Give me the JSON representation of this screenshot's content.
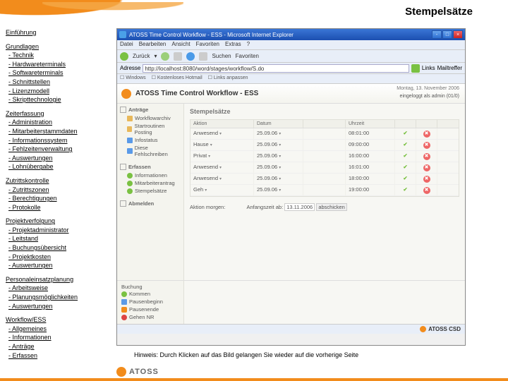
{
  "page": {
    "title": "Stempelsätze",
    "hint": "Hinweis: Durch Klicken auf das Bild gelangen Sie wieder auf die vorherige Seite"
  },
  "nav": [
    {
      "head": "Einführung",
      "items": []
    },
    {
      "head": "Grundlagen",
      "items": [
        "Technik",
        "Hardwareterminals",
        "Softwareterminals",
        "Schnittstellen",
        "Lizenzmodell",
        "Skripttechnologie"
      ]
    },
    {
      "head": "Zeiterfassung",
      "items": [
        "Administration",
        "Mitarbeiterstammdaten",
        "Informationssystem",
        "Fehlzeitenverwaltung",
        "Auswertungen",
        "Lohnübergabe"
      ]
    },
    {
      "head": "Zutrittskontrolle",
      "items": [
        "Zutrittszonen",
        "Berechtigungen",
        "Protokolle"
      ]
    },
    {
      "head": "Projektverfolgung",
      "items": [
        "Projektadministrator",
        "Leitstand",
        "Buchungsübersicht",
        "Projektkosten",
        "Auswertungen"
      ]
    },
    {
      "head": "Personaleinsatzplanung",
      "items": [
        "Arbeitsweise",
        "Planungsmöglichkeiten",
        "Auswertungen"
      ]
    },
    {
      "head": "Workflow/ESS",
      "items": [
        "Allgemeines",
        "Informationen",
        "Anträge",
        "Erfassen"
      ]
    }
  ],
  "browser": {
    "title": "ATOSS Time Control Workflow - ESS - Microsoft Internet Explorer",
    "menus": [
      "Datei",
      "Bearbeiten",
      "Ansicht",
      "Favoriten",
      "Extras",
      "?"
    ],
    "buttons": {
      "back": "Zurück",
      "search": "Suchen",
      "fav": "Favoriten"
    },
    "addr_label": "Adresse",
    "url": "http://localhost:8080/word/stages/workflow/S.do",
    "links_label": "Links",
    "links": [
      "Windows",
      "Kostenloses Hotmail",
      "Links anpassen"
    ],
    "mailtreffer": "Mailtreffer"
  },
  "app": {
    "title": "ATOSS Time Control Workflow - ESS",
    "date": "Montag, 13. November 2006",
    "sub": "eingeloggt als admin (01/0)",
    "sidebar": [
      {
        "head": "Anträge",
        "items": [
          {
            "ico": "folder",
            "label": "Workflowarchiv"
          },
          {
            "ico": "folder",
            "label": "Startroutinen Posting"
          },
          {
            "ico": "blue",
            "label": "Infostatus"
          },
          {
            "ico": "blue",
            "label": "Diese Fehlschreiben"
          }
        ]
      },
      {
        "head": "Erfassen",
        "items": [
          {
            "ico": "green",
            "label": "Informationen"
          },
          {
            "ico": "green",
            "label": "Mitarbeiterantrag"
          },
          {
            "ico": "green",
            "label": "Stempelsätze"
          }
        ]
      },
      {
        "head": "Abmelden",
        "items": []
      }
    ],
    "panel": "Stempelsätze",
    "cols": [
      "Aktion",
      "Datum",
      "Uhrzeit",
      "",
      ""
    ],
    "rows": [
      {
        "a": "Anwesend",
        "d": "25.09.06",
        "u": "08:01:00"
      },
      {
        "a": "Hause",
        "d": "25.09.06",
        "u": "09:00:00"
      },
      {
        "a": "Privat",
        "d": "25.09.06",
        "u": "16:00:00"
      },
      {
        "a": "Anwesend",
        "d": "25.09.06",
        "u": "16:01:00"
      },
      {
        "a": "Anwesend",
        "d": "25.09.06",
        "u": "18:00:00"
      },
      {
        "a": "Geh",
        "d": "25.09.06",
        "u": "19:00:00"
      }
    ],
    "input": {
      "action_label": "Aktion morgen:",
      "date_label": "Anfangszeit ab:",
      "date": "13.11.2006",
      "btn": "abschicken"
    },
    "footer": [
      {
        "head": "Buchung",
        "items": [
          {
            "ico": "green",
            "label": "Kommen"
          },
          {
            "ico": "blue",
            "label": "Pausenbeginn"
          },
          {
            "ico": "orange",
            "label": "Pausenende"
          },
          {
            "ico": "red",
            "label": "Gehen NR"
          }
        ]
      }
    ],
    "brand": "ATOSS CSD"
  },
  "logo": "ATOSS"
}
